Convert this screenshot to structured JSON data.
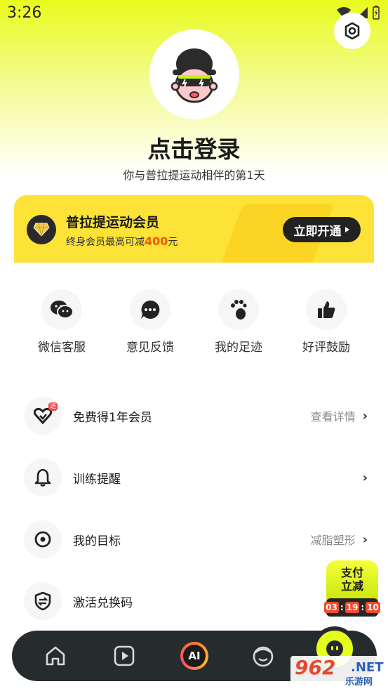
{
  "status_bar": {
    "time": "3:26"
  },
  "profile": {
    "title": "点击登录",
    "subtitle": "你与普拉提运动相伴的第1天"
  },
  "member_card": {
    "title": "普拉提运动会员",
    "desc_prefix": "终身会员最高可减",
    "desc_amount": "400",
    "desc_suffix": "元",
    "button_label": "立即开通"
  },
  "quick_actions": [
    {
      "label": "微信客服",
      "icon": "wechat-icon"
    },
    {
      "label": "意见反馈",
      "icon": "chat-dots-icon"
    },
    {
      "label": "我的足迹",
      "icon": "footprint-icon"
    },
    {
      "label": "好评鼓励",
      "icon": "thumbs-up-icon"
    }
  ],
  "menu_rows": [
    {
      "title": "免费得1年会员",
      "right": "查看详情",
      "icon": "heart-gift-icon",
      "tag": "送"
    },
    {
      "title": "训练提醒",
      "right": "",
      "icon": "bell-icon"
    },
    {
      "title": "我的目标",
      "right": "减脂塑形",
      "icon": "target-icon"
    },
    {
      "title": "激活兑换码",
      "right": "",
      "icon": "exchange-shield-icon"
    }
  ],
  "pay_badge": {
    "line1": "支付",
    "line2": "立减",
    "hours": "03",
    "minutes": "19",
    "seconds": "10"
  },
  "bottom_nav": {
    "ai_label": "AI"
  },
  "watermark": {
    "number": "962",
    "net": ".NET",
    "cn": "乐游网"
  },
  "colors": {
    "accent_yellow": "#e9fb1c",
    "member_card": "#fde237",
    "nav_bg": "#262b2e",
    "highlight": "#f05a00"
  }
}
